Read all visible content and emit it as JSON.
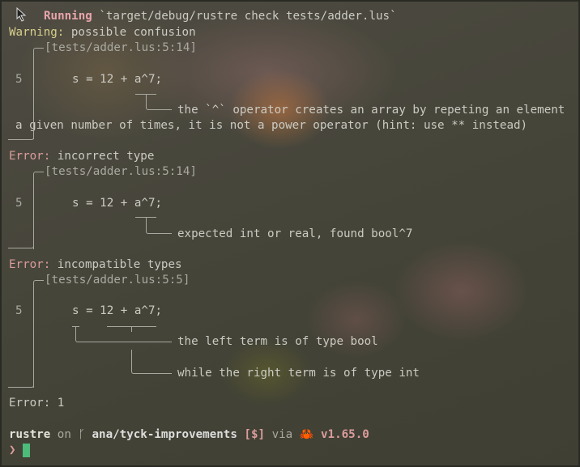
{
  "command_line": {
    "prefix": "Running",
    "command": "`target/debug/rustre check tests/adder.lus`"
  },
  "diagnostics": [
    {
      "level": "Warning:",
      "message": "possible confusion",
      "location": "[tests/adder.lus:5:14]",
      "line_number": "5",
      "code": "s = 12 + a^7;",
      "notes": [
        "the `^` operator creates an array by repeting an element",
        "a given number of times, it is not a power operator (hint: use ** instead)"
      ]
    },
    {
      "level": "Error:",
      "message": "incorrect type",
      "location": "[tests/adder.lus:5:14]",
      "line_number": "5",
      "code": "s = 12 + a^7;",
      "notes": [
        "expected int or real, found bool^7"
      ]
    },
    {
      "level": "Error:",
      "message": "incompatible types",
      "location": "[tests/adder.lus:5:5]",
      "line_number": "5",
      "code": "s = 12 + a^7;",
      "notes": [
        "the left term is of type bool",
        "while the right term is of type int"
      ]
    }
  ],
  "summary": {
    "label": "Error:",
    "count": "1"
  },
  "prompt": {
    "dir": "rustre",
    "on": "on",
    "branch_icon": "git-branch-icon",
    "branch": "ana/tyck-improvements",
    "status": "[$]",
    "via": "via",
    "lang_icon": "rust-crab-icon",
    "version": "v1.65.0",
    "symbol": "❯"
  },
  "colors": {
    "running": "#e8a4ab",
    "warning": "#d9cf8c",
    "error": "#dc9c9c",
    "cursor": "#4dbb7a",
    "crab": "#e2561e"
  }
}
